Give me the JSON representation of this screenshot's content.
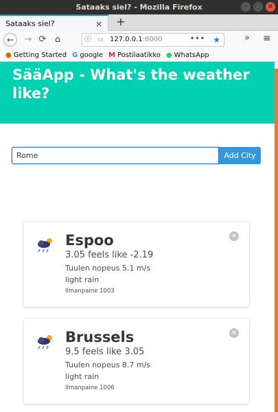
{
  "window": {
    "title": "Sataaks siel? - Mozilla Firefox"
  },
  "tabs": [
    {
      "label": "Sataaks siel?"
    }
  ],
  "navbar": {
    "url_host": "127.0.0.1",
    "url_port": ":8000"
  },
  "bookmarks": [
    {
      "label": "Getting Started",
      "icon": "firefox-icon"
    },
    {
      "label": "google",
      "icon": "google-icon"
    },
    {
      "label": "Postilaatikko",
      "icon": "gmail-icon"
    },
    {
      "label": "WhatsApp",
      "icon": "whatsapp-icon"
    }
  ],
  "hero": {
    "title": "SääApp - What's the weather like?"
  },
  "form": {
    "input_value": "Rome",
    "button_label": "Add City"
  },
  "cards": [
    {
      "city": "Espoo",
      "temp": "3.05 feels like -2.19",
      "wind": "Tuulen nopeus 5.1 m/s",
      "description": "light rain",
      "pressure": "Ilmanpaine 1003",
      "icon": "rain-cloud-icon"
    },
    {
      "city": "Brussels",
      "temp": "9.5 feels like 3.05",
      "wind": "Tuulen nopeus 8.7 m/s",
      "description": "light rain",
      "pressure": "Ilmanpaine 1006",
      "icon": "rain-cloud-icon"
    }
  ],
  "colors": {
    "hero": "#00d1b2",
    "button": "#3298dc",
    "accent": "#0a84ff"
  }
}
